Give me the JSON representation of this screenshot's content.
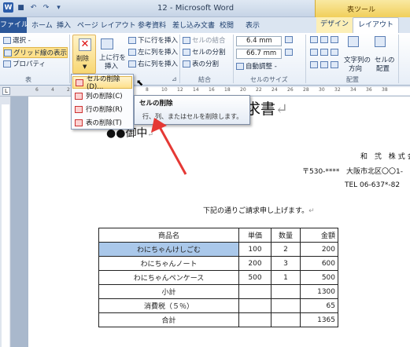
{
  "window": {
    "title": "12 - Microsoft Word",
    "context_tab": "表ツール"
  },
  "qat": {
    "logo": "W",
    "save": "■",
    "undo": "↶",
    "redo": "↷",
    "customize": "▾"
  },
  "tabs": {
    "file": "ファイル",
    "home": "ホーム",
    "insert": "挿入",
    "page_layout": "ページ レイアウト",
    "references": "参考資料",
    "mailings": "差し込み文書",
    "review": "校閲",
    "view": "表示",
    "design": "デザイン",
    "layout": "レイアウト"
  },
  "ribbon": {
    "table": {
      "select": "選択 -",
      "gridlines": "グリッド線の表示",
      "properties": "プロパティ",
      "label": "表"
    },
    "rows_cols": {
      "delete": "削除",
      "delete_arrow": "▼",
      "insert_above": "上に行を",
      "insert_above2": "挿入",
      "insert_below": "下に行を挿入",
      "insert_left": "左に列を挿入",
      "insert_right": "右に列を挿入",
      "launcher": "⊿"
    },
    "merge": {
      "merge_cells": "セルの結合",
      "split_cells": "セルの分割",
      "split_table": "表の分割",
      "label": "結合"
    },
    "cell_size": {
      "height": "6.4 mm",
      "width": "66.7 mm",
      "autofit": "自動調整 -",
      "label": "セルのサイズ"
    },
    "alignment": {
      "text_direction": "文字列の",
      "text_direction2": "方向",
      "cell_margins": "セルの",
      "cell_margins2": "配置",
      "label": "配置"
    }
  },
  "delete_menu": {
    "items": [
      {
        "label": "セルの削除(D)...",
        "highlighted": true
      },
      {
        "label": "列の削除(C)",
        "highlighted": false
      },
      {
        "label": "行の削除(R)",
        "highlighted": false
      },
      {
        "label": "表の削除(T)",
        "highlighted": false
      }
    ]
  },
  "tooltip": {
    "title": "セルの削除",
    "body": "行、列、またはセルを削除します。"
  },
  "document": {
    "title": "請求書",
    "addressee": "●●御中",
    "company": "和 弐 株式会",
    "postal": "〒530-****",
    "address": "大阪市北区〇〇1-",
    "tel": "TEL 06-637*-82",
    "intro": "下記の通りご請求申し上げます。",
    "pilcrow": "↵",
    "table": {
      "headers": [
        "商品名",
        "単価",
        "数量",
        "金額"
      ],
      "rows": [
        [
          "わにちゃんけしごむ",
          "100",
          "2",
          "200"
        ],
        [
          "わにちゃんノート",
          "200",
          "3",
          "600"
        ],
        [
          "わにちゃんペンケース",
          "500",
          "1",
          "500"
        ],
        [
          "小計",
          "",
          "",
          "1300"
        ],
        [
          "消費税（５％）",
          "",
          "",
          "65"
        ],
        [
          "合計",
          "",
          "",
          "1365"
        ]
      ]
    }
  },
  "ruler": {
    "marks": [
      "6",
      "4",
      "2",
      "",
      "2",
      "4",
      "6",
      "8",
      "10",
      "12",
      "14",
      "16",
      "18",
      "20",
      "22",
      "24",
      "26",
      "28",
      "30",
      "32",
      "34",
      "36",
      "38"
    ]
  },
  "colors": {
    "accent": "#2b579a",
    "annotation_arrow": "#e53935",
    "selection": "#aac8ea",
    "context": "#f1cf5b"
  }
}
